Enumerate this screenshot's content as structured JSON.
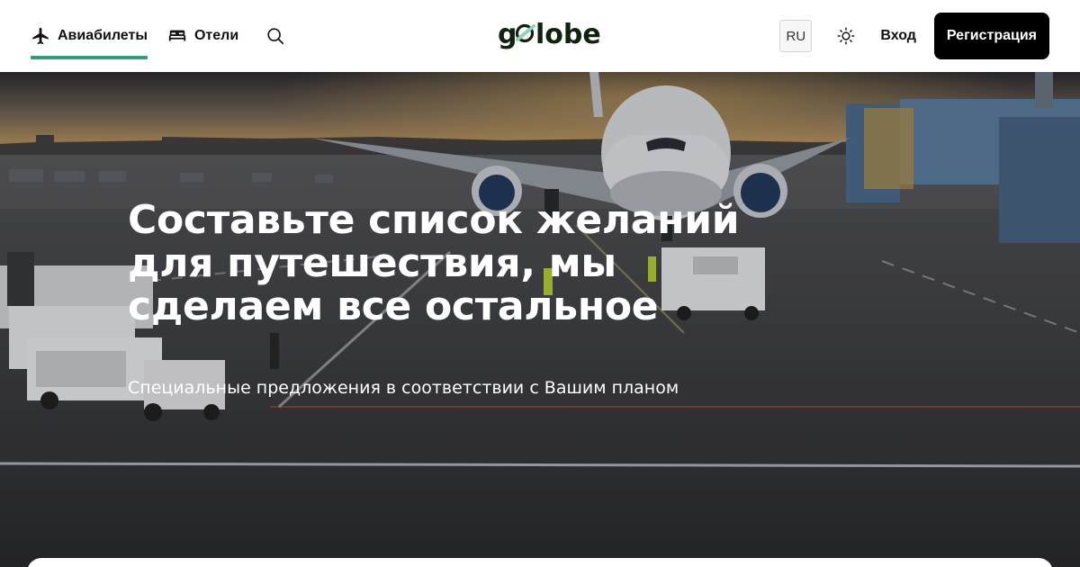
{
  "header": {
    "tabs": [
      {
        "label": "Авиабилеты",
        "icon": "airplane-icon",
        "active": true
      },
      {
        "label": "Отели",
        "icon": "bed-icon",
        "active": false
      }
    ],
    "search_icon": "search-icon",
    "logo_text": "globe",
    "language": "RU",
    "theme_icon": "sun-icon",
    "login_label": "Вход",
    "register_label": "Регистрация"
  },
  "hero": {
    "title": "Составьте список желаний для путешествия, мы сделаем все остальное",
    "subtitle": "Специальные предложения в соответствии с Вашим планом"
  },
  "colors": {
    "accent": "#2f9e76",
    "logo_green": "#8dd3bb",
    "logo_dark": "#112211",
    "button_dark": "#000000"
  }
}
